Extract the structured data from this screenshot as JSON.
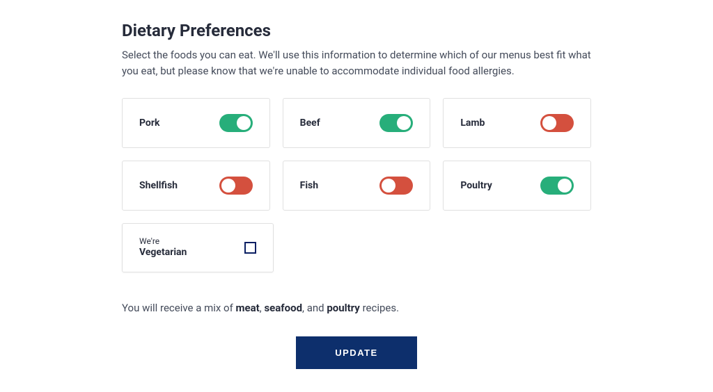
{
  "header": {
    "title": "Dietary Preferences",
    "subtitle": "Select the foods you can eat. We'll use this information to determine which of our menus best fit what you eat, but please know that we're unable to accommodate individual food allergies."
  },
  "prefs": [
    {
      "label": "Pork",
      "enabled": true
    },
    {
      "label": "Beef",
      "enabled": true
    },
    {
      "label": "Lamb",
      "enabled": false
    },
    {
      "label": "Shellfish",
      "enabled": false
    },
    {
      "label": "Fish",
      "enabled": false
    },
    {
      "label": "Poultry",
      "enabled": true
    }
  ],
  "vegetarian": {
    "pre": "We're",
    "label": "Vegetarian",
    "checked": false
  },
  "summary": {
    "prefix": "You will receive a mix of ",
    "part1": "meat",
    "sep1": ", ",
    "part2": "seafood",
    "sep2": ", and ",
    "part3": "poultry",
    "suffix": " recipes."
  },
  "actions": {
    "update_label": "UPDATE"
  },
  "colors": {
    "on": "#27ae7a",
    "off": "#d4503e",
    "primary": "#0d2f6c",
    "check_border": "#0a1f63"
  }
}
